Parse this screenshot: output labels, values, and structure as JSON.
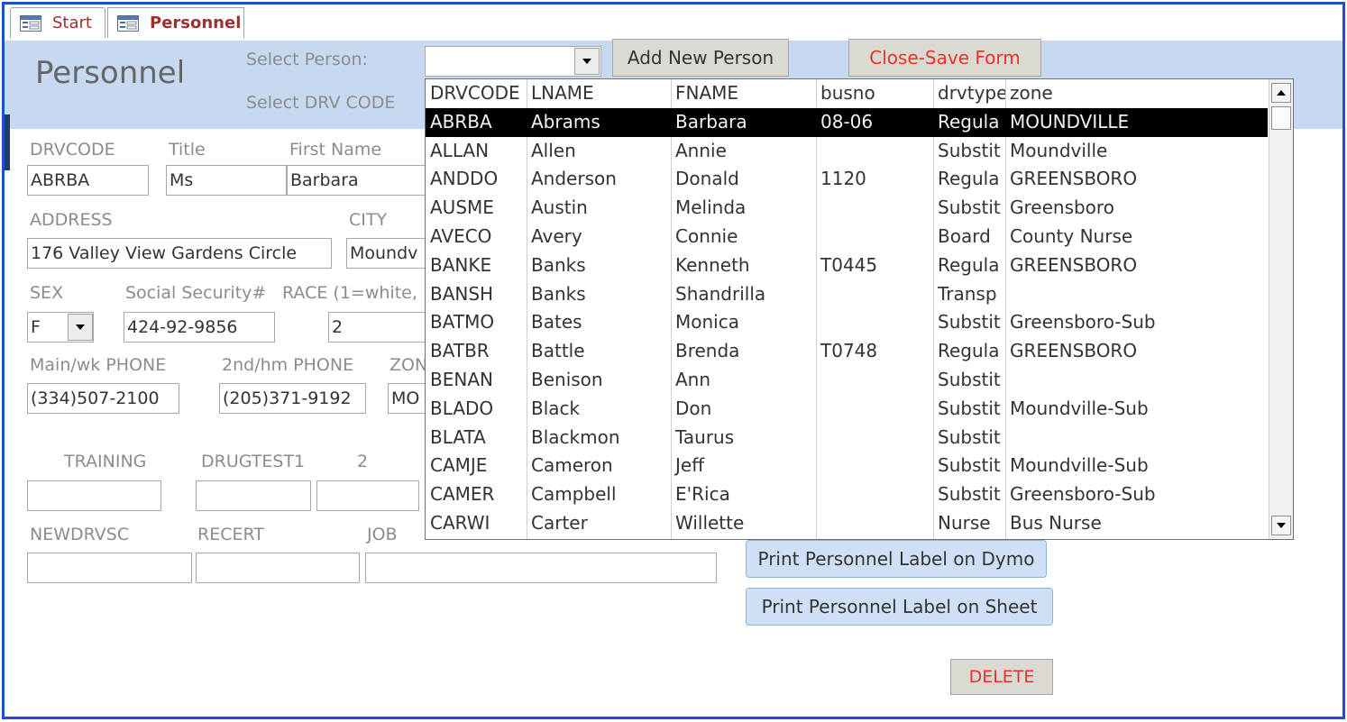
{
  "tabs": [
    {
      "label": "Start",
      "icon": "form-icon"
    },
    {
      "label": "Personnel",
      "icon": "form-icon"
    }
  ],
  "page_title": "Personnel",
  "select_person": {
    "label": "Select Person:",
    "value": ""
  },
  "select_drv_code_label": "Select DRV CODE",
  "buttons": {
    "add_new_person": "Add New Person",
    "close_save": "Close-Save Form",
    "print_dymo": "Print Personnel Label on Dymo",
    "print_sheet": "Print Personnel Label on Sheet",
    "delete": "DELETE"
  },
  "colors": {
    "accent_red": "#e8332b",
    "header_blue": "#c6d9f1",
    "frame_blue": "#1f4fd0"
  },
  "form": {
    "drvcode": {
      "label": "DRVCODE",
      "value": "ABRBA"
    },
    "title": {
      "label": "Title",
      "value": "Ms"
    },
    "first_name": {
      "label": "First Name",
      "value": "Barbara"
    },
    "address": {
      "label": "ADDRESS",
      "value": "176 Valley View Gardens Circle"
    },
    "city": {
      "label": "CITY",
      "value": "Moundv"
    },
    "sex": {
      "label": "SEX",
      "value": "F"
    },
    "ssn": {
      "label": "Social Security#",
      "value": "424-92-9856"
    },
    "race": {
      "label": "RACE (1=white,",
      "value": "2"
    },
    "main_phone": {
      "label": "Main/wk PHONE",
      "value": "(334)507-2100"
    },
    "hm_phone": {
      "label": "2nd/hm PHONE",
      "value": "(205)371-9192"
    },
    "zone": {
      "label": "ZON",
      "value": "MO"
    },
    "training": {
      "label": "TRAINING",
      "value": ""
    },
    "drugtest1": {
      "label": "DRUGTEST1",
      "value": ""
    },
    "drugtest2": {
      "label": "2",
      "value": ""
    },
    "newdrvsc": {
      "label": "NEWDRVSC",
      "value": ""
    },
    "recert": {
      "label": "RECERT",
      "value": ""
    },
    "job": {
      "label": "JOB",
      "value": ""
    }
  },
  "dropdown": {
    "columns": [
      "DRVCODE",
      "LNAME",
      "FNAME",
      "busno",
      "drvtype",
      "zone"
    ],
    "rows": [
      [
        "ABRBA",
        "Abrams",
        "Barbara",
        "08-06",
        "Regula",
        "MOUNDVILLE"
      ],
      [
        "ALLAN",
        "Allen",
        "Annie",
        "",
        "Substit",
        "Moundville"
      ],
      [
        "ANDDO",
        "Anderson",
        "Donald",
        "1120",
        "Regula",
        "GREENSBORO"
      ],
      [
        "AUSME",
        "Austin",
        "Melinda",
        "",
        "Substit",
        "Greensboro"
      ],
      [
        "AVECO",
        "Avery",
        "Connie",
        "",
        "Board",
        "County Nurse"
      ],
      [
        "BANKE",
        "Banks",
        "Kenneth",
        "T0445",
        "Regula",
        "GREENSBORO"
      ],
      [
        "BANSH",
        "Banks",
        "Shandrilla",
        "",
        "Transp",
        ""
      ],
      [
        "BATMO",
        "Bates",
        "Monica",
        "",
        "Substit",
        "Greensboro-Sub"
      ],
      [
        "BATBR",
        "Battle",
        "Brenda",
        "T0748",
        "Regula",
        "GREENSBORO"
      ],
      [
        "BENAN",
        "Benison",
        "Ann",
        "",
        "Substit",
        ""
      ],
      [
        "BLADO",
        "Black",
        "Don",
        "",
        "Substit",
        "Moundville-Sub"
      ],
      [
        "BLATA",
        "Blackmon",
        "Taurus",
        "",
        "Substit",
        ""
      ],
      [
        "CAMJE",
        "Cameron",
        "Jeff",
        "",
        "Substit",
        "Moundville-Sub"
      ],
      [
        "CAMER",
        "Campbell",
        "E'Rica",
        "",
        "Substit",
        "Greensboro-Sub"
      ],
      [
        "CARWI",
        "Carter",
        "Willette",
        "",
        "Nurse",
        "Bus Nurse"
      ]
    ]
  }
}
